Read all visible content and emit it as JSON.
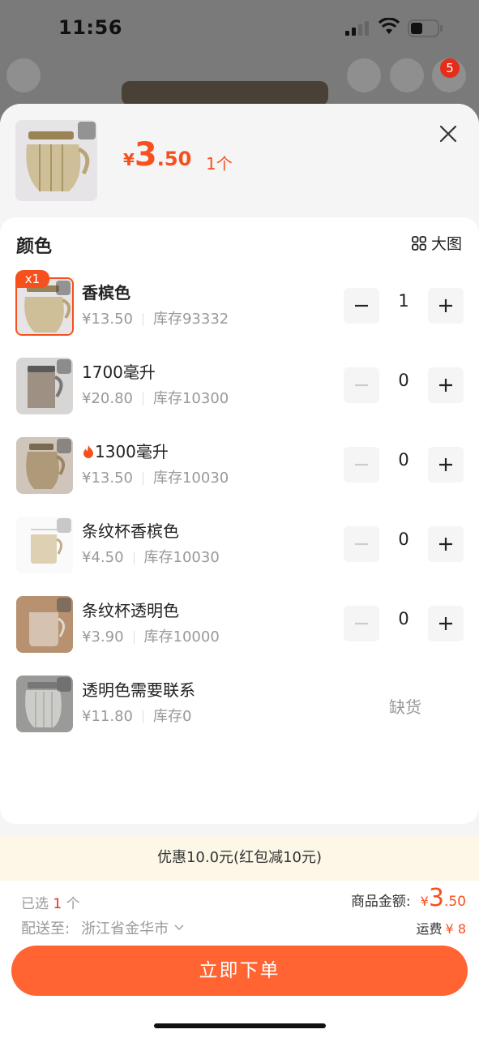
{
  "status_bar": {
    "time": "11:56"
  },
  "background_nav": {
    "cart_badge": "5"
  },
  "header": {
    "price_yen": "¥",
    "price_int": "3",
    "price_dec": ".50",
    "quantity_text": "1个"
  },
  "section": {
    "title": "颜色",
    "big_pic_label": "大图"
  },
  "items": [
    {
      "name": "香槟色",
      "price": "¥13.50",
      "stock": "库存93332",
      "qty": "1",
      "selected": true,
      "badge": "x1"
    },
    {
      "name": "1700毫升",
      "price": "¥20.80",
      "stock": "库存10300",
      "qty": "0"
    },
    {
      "name": "1300毫升",
      "price": "¥13.50",
      "stock": "库存10030",
      "qty": "0",
      "hot": true
    },
    {
      "name": "条纹杯香槟色",
      "price": "¥4.50",
      "stock": "库存10030",
      "qty": "0"
    },
    {
      "name": "条纹杯透明色",
      "price": "¥3.90",
      "stock": "库存10000",
      "qty": "0"
    },
    {
      "name": "透明色需要联系",
      "price": "¥11.80",
      "stock": "库存0",
      "out_of_stock": "缺货"
    }
  ],
  "promo": {
    "text": "优惠10.0元(红包减10元)"
  },
  "footer": {
    "selected_prefix": "已选",
    "selected_num": "1",
    "selected_suffix": "个",
    "total_label": "商品金额:",
    "total_yen": "¥",
    "total_int": "3",
    "total_dec": ".50",
    "ship_label": "配送至:",
    "ship_addr": "浙江省金华市",
    "freight_label": "运费",
    "freight_value": "¥ 8",
    "order_button": "立即下单"
  },
  "colors": {
    "accent": "#f5501e",
    "button": "#ff6432",
    "promo_bg": "#fdf7e7"
  }
}
